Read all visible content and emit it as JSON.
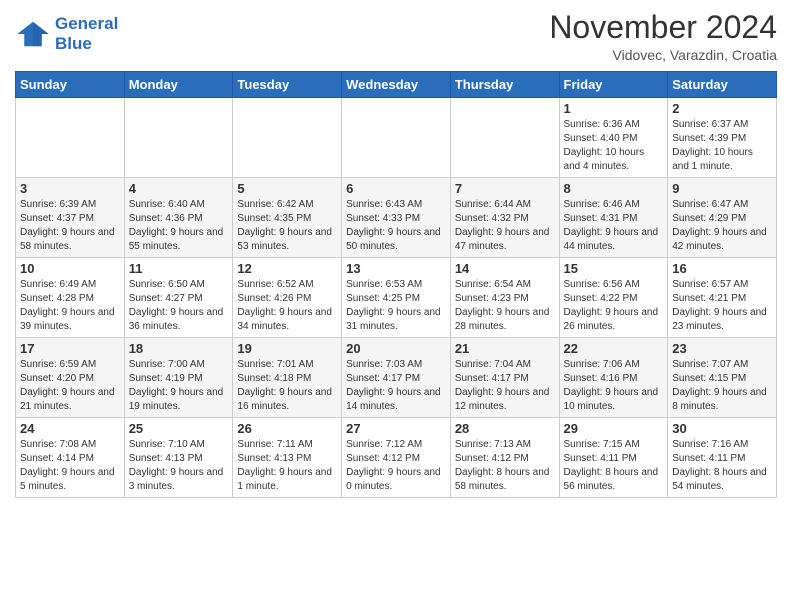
{
  "header": {
    "logo_line1": "General",
    "logo_line2": "Blue",
    "month": "November 2024",
    "location": "Vidovec, Varazdin, Croatia"
  },
  "days_of_week": [
    "Sunday",
    "Monday",
    "Tuesday",
    "Wednesday",
    "Thursday",
    "Friday",
    "Saturday"
  ],
  "weeks": [
    [
      {
        "day": "",
        "info": ""
      },
      {
        "day": "",
        "info": ""
      },
      {
        "day": "",
        "info": ""
      },
      {
        "day": "",
        "info": ""
      },
      {
        "day": "",
        "info": ""
      },
      {
        "day": "1",
        "info": "Sunrise: 6:36 AM\nSunset: 4:40 PM\nDaylight: 10 hours and 4 minutes."
      },
      {
        "day": "2",
        "info": "Sunrise: 6:37 AM\nSunset: 4:39 PM\nDaylight: 10 hours and 1 minute."
      }
    ],
    [
      {
        "day": "3",
        "info": "Sunrise: 6:39 AM\nSunset: 4:37 PM\nDaylight: 9 hours and 58 minutes."
      },
      {
        "day": "4",
        "info": "Sunrise: 6:40 AM\nSunset: 4:36 PM\nDaylight: 9 hours and 55 minutes."
      },
      {
        "day": "5",
        "info": "Sunrise: 6:42 AM\nSunset: 4:35 PM\nDaylight: 9 hours and 53 minutes."
      },
      {
        "day": "6",
        "info": "Sunrise: 6:43 AM\nSunset: 4:33 PM\nDaylight: 9 hours and 50 minutes."
      },
      {
        "day": "7",
        "info": "Sunrise: 6:44 AM\nSunset: 4:32 PM\nDaylight: 9 hours and 47 minutes."
      },
      {
        "day": "8",
        "info": "Sunrise: 6:46 AM\nSunset: 4:31 PM\nDaylight: 9 hours and 44 minutes."
      },
      {
        "day": "9",
        "info": "Sunrise: 6:47 AM\nSunset: 4:29 PM\nDaylight: 9 hours and 42 minutes."
      }
    ],
    [
      {
        "day": "10",
        "info": "Sunrise: 6:49 AM\nSunset: 4:28 PM\nDaylight: 9 hours and 39 minutes."
      },
      {
        "day": "11",
        "info": "Sunrise: 6:50 AM\nSunset: 4:27 PM\nDaylight: 9 hours and 36 minutes."
      },
      {
        "day": "12",
        "info": "Sunrise: 6:52 AM\nSunset: 4:26 PM\nDaylight: 9 hours and 34 minutes."
      },
      {
        "day": "13",
        "info": "Sunrise: 6:53 AM\nSunset: 4:25 PM\nDaylight: 9 hours and 31 minutes."
      },
      {
        "day": "14",
        "info": "Sunrise: 6:54 AM\nSunset: 4:23 PM\nDaylight: 9 hours and 28 minutes."
      },
      {
        "day": "15",
        "info": "Sunrise: 6:56 AM\nSunset: 4:22 PM\nDaylight: 9 hours and 26 minutes."
      },
      {
        "day": "16",
        "info": "Sunrise: 6:57 AM\nSunset: 4:21 PM\nDaylight: 9 hours and 23 minutes."
      }
    ],
    [
      {
        "day": "17",
        "info": "Sunrise: 6:59 AM\nSunset: 4:20 PM\nDaylight: 9 hours and 21 minutes."
      },
      {
        "day": "18",
        "info": "Sunrise: 7:00 AM\nSunset: 4:19 PM\nDaylight: 9 hours and 19 minutes."
      },
      {
        "day": "19",
        "info": "Sunrise: 7:01 AM\nSunset: 4:18 PM\nDaylight: 9 hours and 16 minutes."
      },
      {
        "day": "20",
        "info": "Sunrise: 7:03 AM\nSunset: 4:17 PM\nDaylight: 9 hours and 14 minutes."
      },
      {
        "day": "21",
        "info": "Sunrise: 7:04 AM\nSunset: 4:17 PM\nDaylight: 9 hours and 12 minutes."
      },
      {
        "day": "22",
        "info": "Sunrise: 7:06 AM\nSunset: 4:16 PM\nDaylight: 9 hours and 10 minutes."
      },
      {
        "day": "23",
        "info": "Sunrise: 7:07 AM\nSunset: 4:15 PM\nDaylight: 9 hours and 8 minutes."
      }
    ],
    [
      {
        "day": "24",
        "info": "Sunrise: 7:08 AM\nSunset: 4:14 PM\nDaylight: 9 hours and 5 minutes."
      },
      {
        "day": "25",
        "info": "Sunrise: 7:10 AM\nSunset: 4:13 PM\nDaylight: 9 hours and 3 minutes."
      },
      {
        "day": "26",
        "info": "Sunrise: 7:11 AM\nSunset: 4:13 PM\nDaylight: 9 hours and 1 minute."
      },
      {
        "day": "27",
        "info": "Sunrise: 7:12 AM\nSunset: 4:12 PM\nDaylight: 9 hours and 0 minutes."
      },
      {
        "day": "28",
        "info": "Sunrise: 7:13 AM\nSunset: 4:12 PM\nDaylight: 8 hours and 58 minutes."
      },
      {
        "day": "29",
        "info": "Sunrise: 7:15 AM\nSunset: 4:11 PM\nDaylight: 8 hours and 56 minutes."
      },
      {
        "day": "30",
        "info": "Sunrise: 7:16 AM\nSunset: 4:11 PM\nDaylight: 8 hours and 54 minutes."
      }
    ]
  ]
}
